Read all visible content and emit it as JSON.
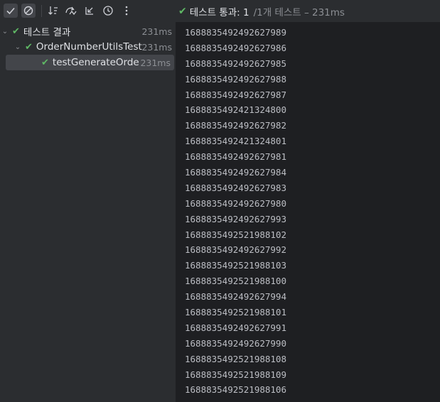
{
  "toolbar": {
    "status_text": "테스트 통과: 1",
    "status_sub": "/1개 테스트 – 231ms"
  },
  "tree": [
    {
      "label": "테스트 결과",
      "duration": "231ms"
    },
    {
      "label": "OrderNumberUtilsTest",
      "duration": "231ms"
    },
    {
      "label": "testGenerateOrderN",
      "duration": "231ms"
    }
  ],
  "output_lines": [
    "1688835492492627989",
    "1688835492492627986",
    "1688835492492627985",
    "1688835492492627988",
    "1688835492492627987",
    "1688835492421324800",
    "1688835492492627982",
    "1688835492421324801",
    "1688835492492627981",
    "1688835492492627984",
    "1688835492492627983",
    "1688835492492627980",
    "1688835492492627993",
    "1688835492521988102",
    "1688835492492627992",
    "1688835492521988103",
    "1688835492521988100",
    "1688835492492627994",
    "1688835492521988101",
    "1688835492492627991",
    "1688835492492627990",
    "1688835492521988108",
    "1688835492521988109",
    "1688835492521988106"
  ],
  "icons": [
    "check-toggle-icon",
    "cancel-icon",
    "sort-icon",
    "import-icon",
    "collapse-icon",
    "history-icon",
    "more-icon",
    "check-icon",
    "chevron-down-icon"
  ],
  "colors": {
    "pass": "#5fb865",
    "output_bg": "#1e1f22",
    "panel_bg": "#2b2d30"
  }
}
